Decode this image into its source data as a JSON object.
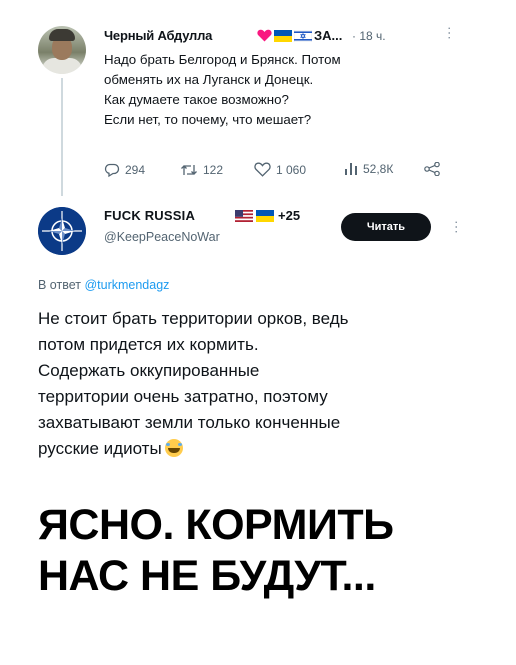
{
  "tweet1": {
    "author_name": "Черный Абдулла",
    "name_suffix": "ЗА...",
    "time": "· 18 ч.",
    "text_lines": [
      "Надо брать Белгород и Брянск. Потом",
      "обменять их на Луганск и Донецк.",
      "Как думаете такое возможно?",
      "Если нет, то почему, что мешает?"
    ],
    "replies": "294",
    "reposts": "122",
    "likes": "1 060",
    "views": "52,8К",
    "icons": [
      "heart-emoji-icon",
      "flag-ukraine-icon",
      "flag-israel-icon",
      "reply-icon",
      "repost-icon",
      "like-icon",
      "views-icon",
      "share-icon",
      "more-icon"
    ]
  },
  "tweet2": {
    "author_name": "FUCK RUSSIA",
    "name_suffix": "+25",
    "handle": "@KeepPeaceNoWar",
    "read_button": "Читать",
    "reply_prefix": "В ответ",
    "reply_mention": "@turkmendagz",
    "text_lines": [
      "Не стоит брать территории орков, ведь",
      "потом придется их кормить.",
      "Содержать оккупированные",
      "территории очень затратно, поэтому",
      "захватывают земли только конченные",
      "русские идиоты"
    ],
    "icons": [
      "nato-logo-icon",
      "flag-usa-icon",
      "flag-ukraine-icon",
      "laughing-emoji-icon",
      "more-icon"
    ]
  },
  "caption": {
    "lines": [
      "ЯСНО. КОРМИТЬ",
      "НАС НЕ БУДУТ..."
    ]
  },
  "colors": {
    "text": "#0f1419",
    "secondary": "#536471",
    "link": "#1d9bf0",
    "button_bg": "#0f1419",
    "heart": "#f91880",
    "ukraine_blue": "#0057b7",
    "ukraine_yellow": "#ffd700",
    "nato_blue": "#0b3a87"
  }
}
